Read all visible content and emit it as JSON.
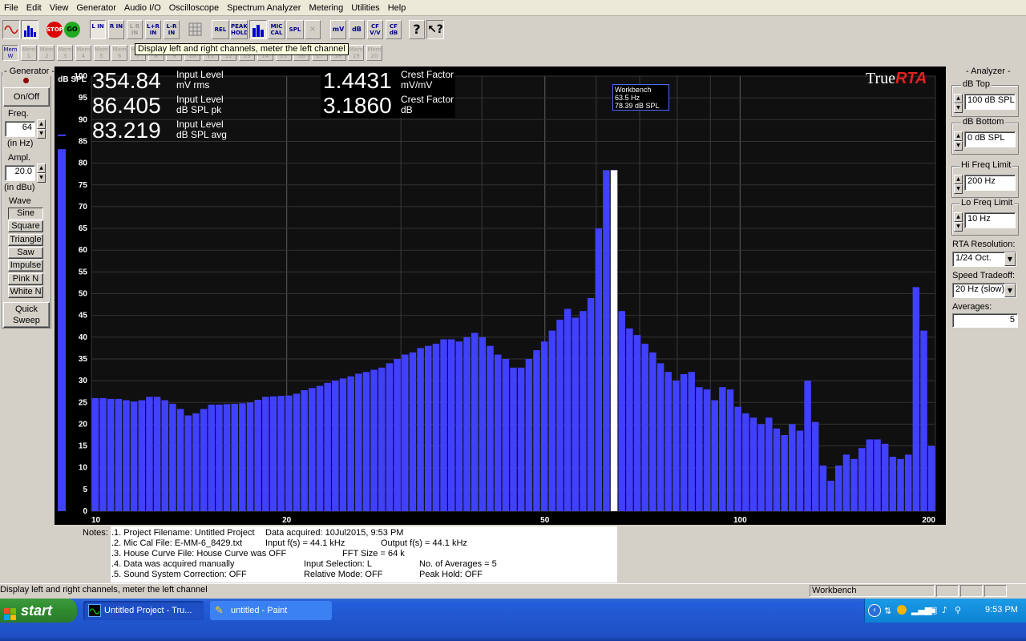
{
  "menu": [
    "File",
    "Edit",
    "View",
    "Generator",
    "Audio I/O",
    "Oscilloscope",
    "Spectrum Analyzer",
    "Metering",
    "Utilities",
    "Help"
  ],
  "toolbar": {
    "line_in": "L IN",
    "r_in": "R IN",
    "lr_in": "L R IN",
    "lpr_in": "L+R IN",
    "lmr_in": "L-R IN",
    "rel": "REL",
    "peak_hold": "PEAK HOLD",
    "mic_cal": "MIC CAL",
    "spl": "SPL",
    "mv": "mV",
    "db": "dB",
    "cf_vv": "CF V/V",
    "cf_db": "CF dB"
  },
  "mem": {
    "active_label": "Mem W",
    "label": "Mem"
  },
  "tooltip": "Display left and right channels, meter the left channel",
  "generator": {
    "title": "- Generator -",
    "onoff": "On/Off",
    "freq_label": "Freq.",
    "freq_value": "64",
    "freq_unit": "(in Hz)",
    "ampl_label": "Ampl.",
    "ampl_value": "20.0",
    "ampl_unit": "(in dBu)",
    "wave_label": "Wave",
    "waves": [
      "Sine",
      "Square",
      "Triangle",
      "Saw",
      "Impulse",
      "Pink N",
      "White N"
    ],
    "quick_sweep": "Quick Sweep"
  },
  "analyzer": {
    "title": "- Analyzer -",
    "db_top_label": "dB Top",
    "db_top_value": "100 dB SPL",
    "db_bottom_label": "dB Bottom",
    "db_bottom_value": "0 dB SPL",
    "hi_freq_label": "Hi Freq Limit",
    "hi_freq_value": "200 Hz",
    "lo_freq_label": "Lo Freq Limit",
    "lo_freq_value": "10 Hz",
    "rta_res_label": "RTA Resolution:",
    "rta_res_value": "1/24 Oct.",
    "speed_label": "Speed Tradeoff:",
    "speed_value": "20 Hz (slow)",
    "averages_label": "Averages:",
    "averages_value": "5"
  },
  "readouts": {
    "input_level_mv": "354.84",
    "input_level_mv_label": "Input Level",
    "input_level_mv_unit": "mV rms",
    "input_level_pk": "86.405",
    "input_level_pk_label": "Input Level",
    "input_level_pk_unit": "dB SPL pk",
    "input_level_avg": "83.219",
    "input_level_avg_label": "Input Level",
    "input_level_avg_unit": "dB SPL avg",
    "crest_vv": "1.4431",
    "crest_vv_label": "Crest Factor",
    "crest_vv_unit": "mV/mV",
    "crest_db": "3.1860",
    "crest_db_label": "Crest Factor",
    "crest_db_unit": "dB"
  },
  "brand": {
    "part1": "True",
    "part2": "RTA"
  },
  "cursor_box": {
    "line1": "Workbench",
    "line2": "63.5 Hz",
    "line3": "78.39 dB SPL"
  },
  "chart_data": {
    "type": "bar",
    "ylabel": "dB SPL",
    "ylim": [
      0,
      100
    ],
    "y_ticks": [
      "0",
      "5",
      "10",
      "15",
      "20",
      "25",
      "30",
      "35",
      "40",
      "45",
      "50",
      "55",
      "60",
      "65",
      "70",
      "75",
      "80",
      "85",
      "90",
      "95",
      "100"
    ],
    "x_tick_labels": [
      {
        "label": "10",
        "freq": 10
      },
      {
        "label": "20",
        "freq": 20
      },
      {
        "label": "50",
        "freq": 50
      },
      {
        "label": "100",
        "freq": 100
      },
      {
        "label": "200",
        "freq": 200
      }
    ],
    "xlim_hz": [
      10,
      200
    ],
    "bar_color": "#4040ff",
    "cursor_color": "#ffffff",
    "cursor_freq_hz": 63.5,
    "cursor_value": 78.39,
    "meter_value": 83.2,
    "values": [
      26,
      26,
      25.8,
      25.8,
      25.5,
      25.2,
      25.5,
      26.3,
      26.3,
      25.5,
      24.7,
      23.5,
      22,
      22.5,
      23.5,
      24.5,
      24.5,
      24.6,
      24.7,
      24.8,
      25,
      25.6,
      26.3,
      26.4,
      26.5,
      26.6,
      27,
      27.8,
      28.3,
      28.8,
      29.5,
      30,
      30.5,
      31,
      31.6,
      32,
      32.5,
      33,
      34,
      35,
      36,
      36.5,
      37.5,
      38,
      38.5,
      39.5,
      39.5,
      39,
      40,
      41,
      40,
      38,
      36,
      35,
      33,
      33,
      35,
      37,
      39,
      41.5,
      44,
      46.5,
      44.5,
      46,
      49,
      65,
      78.39,
      74,
      46,
      42,
      40.5,
      38.5,
      36.5,
      34,
      32,
      30,
      31.5,
      32,
      28.5,
      28,
      25.5,
      28.5,
      28,
      24,
      22.5,
      21.5,
      20,
      21.5,
      19,
      17.5,
      20,
      18.5,
      30,
      20.5,
      10.5,
      7,
      10.5,
      13,
      12,
      14.5,
      16.5,
      16.5,
      15.5,
      12.5,
      12,
      13,
      51.5,
      41.5,
      15
    ]
  },
  "notes": {
    "label": "Notes:",
    "line1a": ".1. Project Filename: Untitled Project",
    "line1b": "Data acquired: 10Jul2015, 9:53 PM",
    "line2a": ".2. Mic Cal File: E-MM-6_8429.txt",
    "line2b": "Input f(s) = 44.1 kHz",
    "line2c": "Output f(s) = 44.1 kHz",
    "line3a": ".3. House Curve File: House Curve was OFF",
    "line3b": "FFT Size = 64 k",
    "line4a": ".4. Data was acquired manually",
    "line4b": "Input Selection: L",
    "line4c": "No. of Averages = 5",
    "line5a": ".5. Sound System Correction: OFF",
    "line5b": "Relative Mode:  OFF",
    "line5c": "Peak Hold: OFF"
  },
  "status": {
    "left": "Display left and right channels, meter the left channel",
    "right": "Workbench"
  },
  "taskbar": {
    "start": "start",
    "task1": "Untitled Project - Tru...",
    "task2": "untitled - Paint",
    "clock": "9:53 PM"
  }
}
